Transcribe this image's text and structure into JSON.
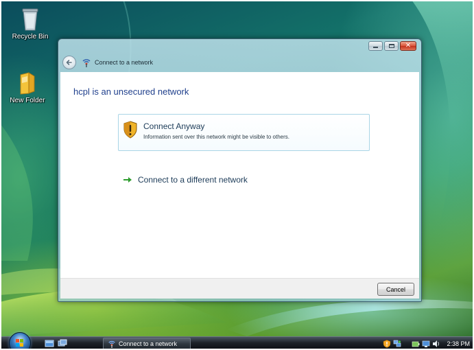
{
  "desktop": {
    "icons": [
      {
        "label": "Recycle Bin",
        "icon": "recycle-bin-icon"
      },
      {
        "label": "New Folder",
        "icon": "folder-icon"
      }
    ]
  },
  "window": {
    "header_title": "Connect to a network",
    "controls": {
      "minimize_icon": "minimize-icon",
      "maximize_icon": "maximize-icon",
      "close_icon": "close-icon"
    },
    "main_title": "hcpl is an unsecured network",
    "option": {
      "title": "Connect Anyway",
      "description": "Information sent over this network might be visible to others.",
      "icon": "shield-warning-icon"
    },
    "link": {
      "text": "Connect to a different network",
      "icon": "green-arrow-icon"
    },
    "cancel_label": "Cancel"
  },
  "taskbar": {
    "task_label": "Connect to a network",
    "clock": "2:38 PM",
    "tray_icons": [
      "shield-alert-icon",
      "network-icon",
      "power-icon",
      "speaker-icon"
    ]
  },
  "colors": {
    "title_blue": "#1f3f8c",
    "card_border": "#a9d5e6",
    "link_arrow_green": "#2e9d2e"
  }
}
